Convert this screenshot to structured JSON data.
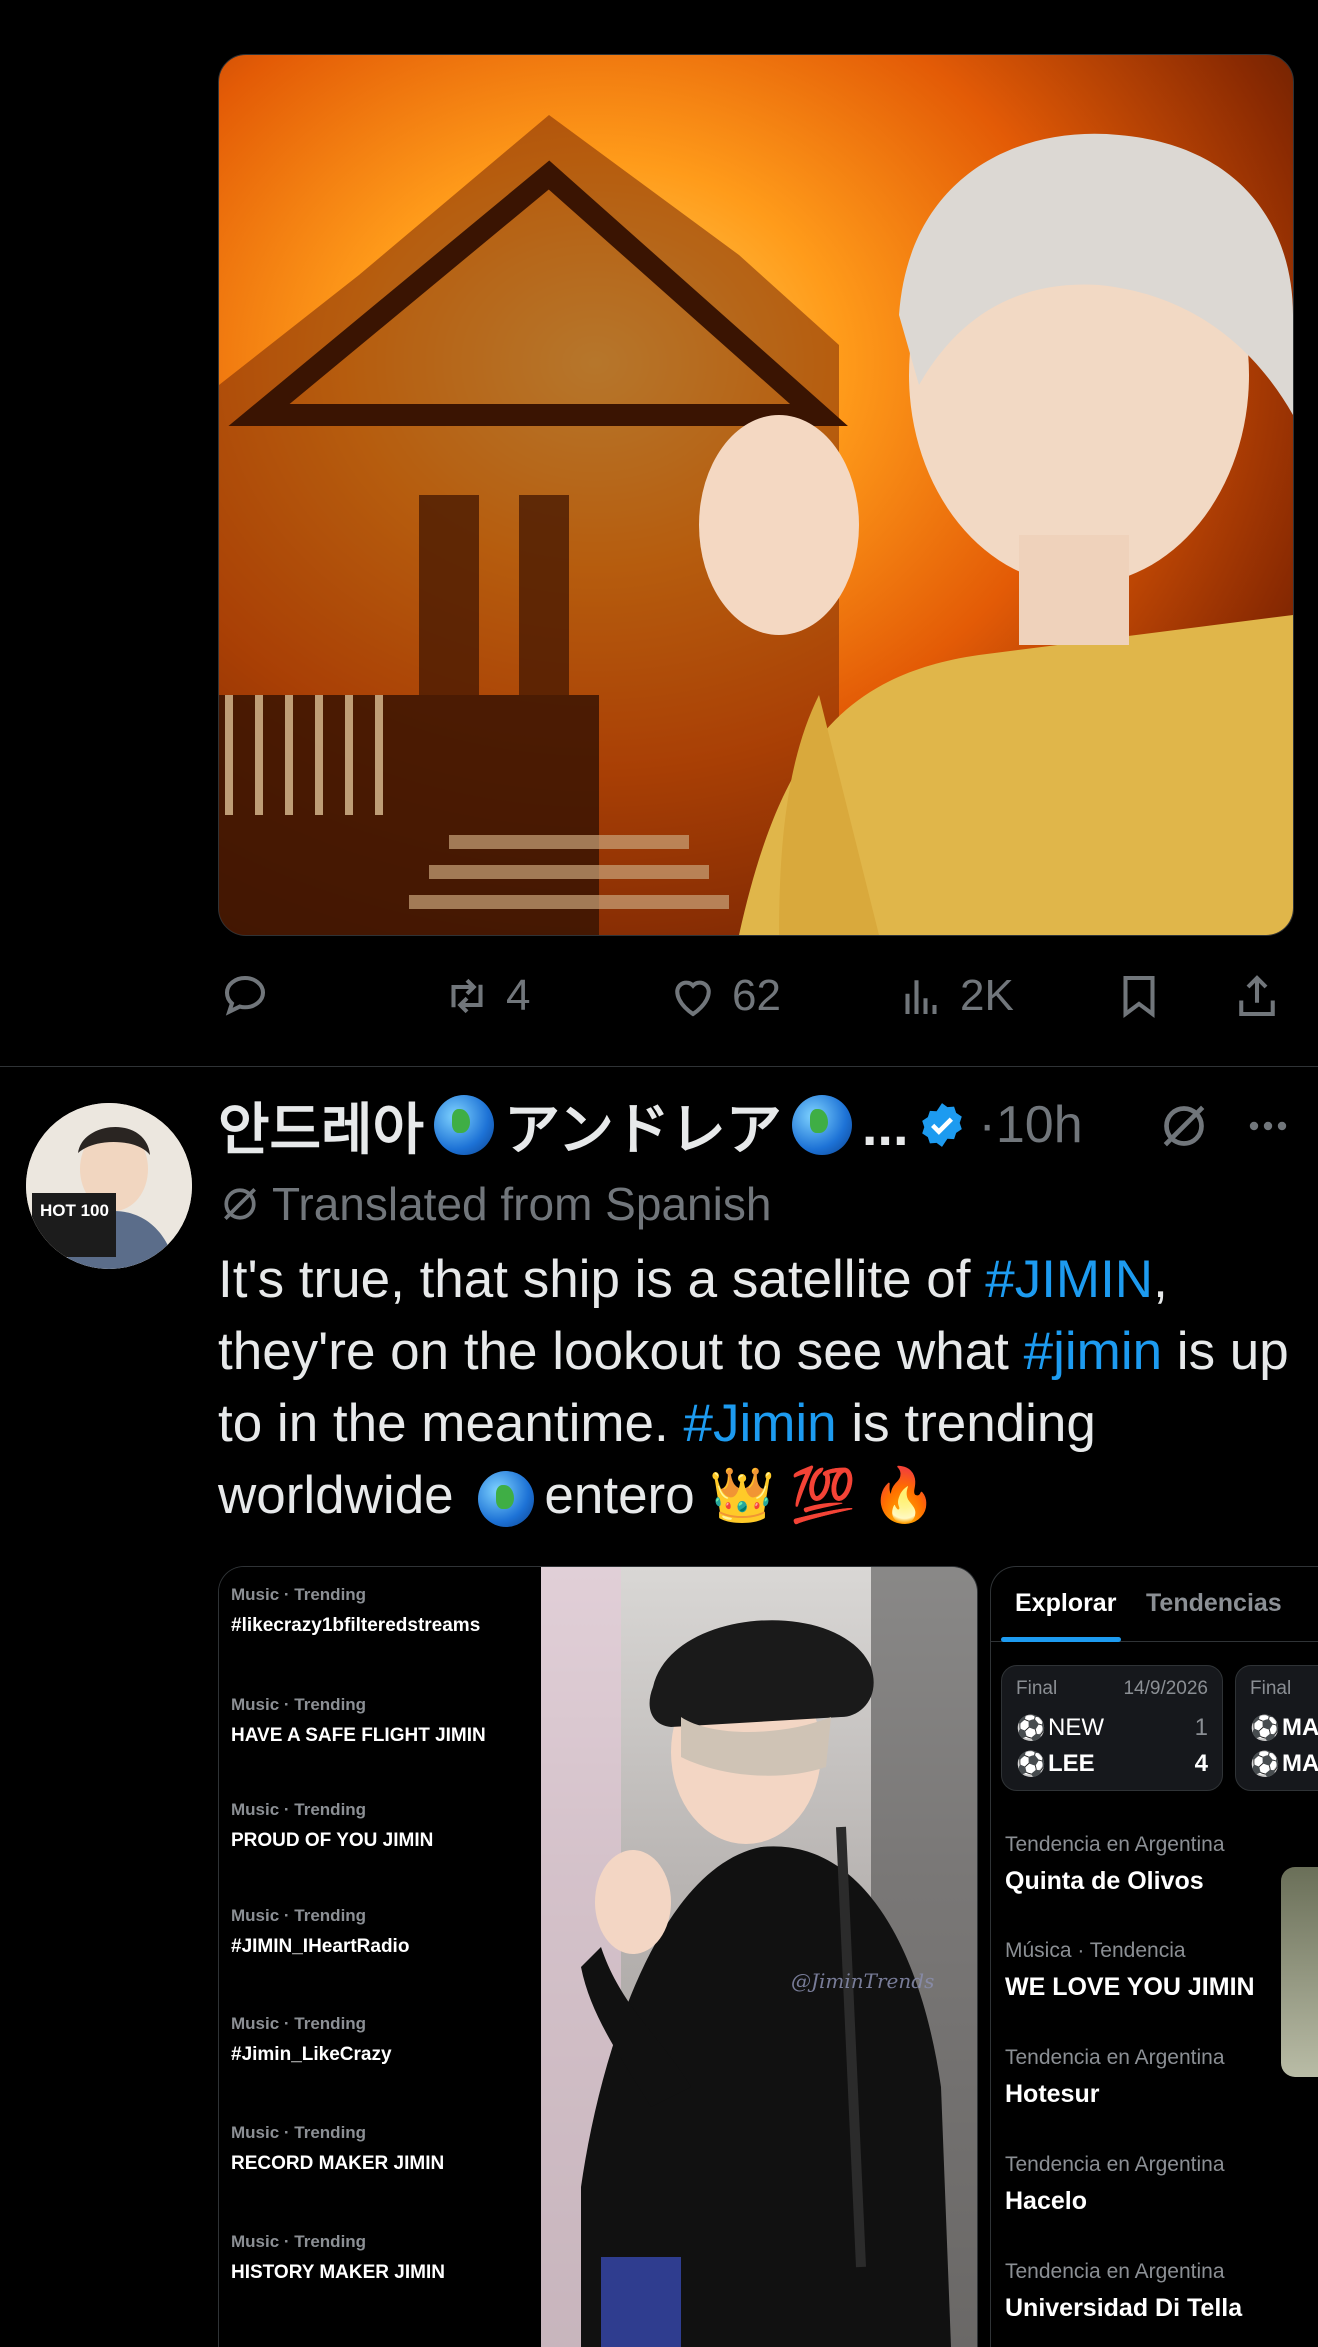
{
  "top_tweet": {
    "image_alt": "Person in yellow sweater in front of a burning house",
    "actions": {
      "reply_count": "",
      "retweet_count": "4",
      "like_count": "62",
      "view_count": "2K"
    }
  },
  "tweet": {
    "display_name": "안드레아",
    "display_name_2": "アンドレア",
    "ellipsis": "...",
    "time": "·10h",
    "translated_label": "Translated from Spanish",
    "text": {
      "p1": "It's true, that ship is a satellite of ",
      "h1": "#JIMIN",
      "p2": ", they're on the lookout to see what ",
      "h2": "#jimin",
      "p3": " is up to in the meantime. ",
      "h3": "#Jimin",
      "p4": " is trending worldwide ",
      "p5": "entero ",
      "emoji": "👑 💯 🔥"
    },
    "avatar_badge": "HOT 100"
  },
  "media_trends": [
    {
      "category": "Music · Trending",
      "title": "#likecrazy1bfilteredstreams"
    },
    {
      "category": "Music · Trending",
      "title": "HAVE A SAFE FLIGHT JIMIN"
    },
    {
      "category": "Music · Trending",
      "title": "PROUD OF YOU JIMIN"
    },
    {
      "category": "Music · Trending",
      "title": "#JIMIN_IHeartRadio"
    },
    {
      "category": "Music · Trending",
      "title": "#Jimin_LikeCrazy"
    },
    {
      "category": "Music · Trending",
      "title": "RECORD MAKER JIMIN"
    },
    {
      "category": "Music · Trending",
      "title": "HISTORY MAKER JIMIN"
    }
  ],
  "watermark": "@JiminTrends",
  "explore": {
    "tab_active": "Explorar",
    "tab_inactive": "Tendencias",
    "score1": {
      "label": "Final",
      "date": "14/9/2026",
      "team1": "NEW",
      "score1": "1",
      "team2": "LEE",
      "score2": "4"
    },
    "score2": {
      "label": "Final",
      "team1": "MA",
      "team2": "MA"
    },
    "trends": [
      {
        "category": "Tendencia en Argentina",
        "title": "Quinta de Olivos"
      },
      {
        "category": "Música · Tendencia",
        "title": "WE LOVE YOU JIMIN"
      },
      {
        "category": "Tendencia en Argentina",
        "title": "Hotesur"
      },
      {
        "category": "Tendencia en Argentina",
        "title": "Hacelo"
      },
      {
        "category": "Tendencia en Argentina",
        "title": "Universidad Di Tella"
      }
    ]
  },
  "colors": {
    "accent": "#1d9bf0",
    "muted": "#71767b",
    "text": "#e7e9ea",
    "background": "#000000"
  }
}
